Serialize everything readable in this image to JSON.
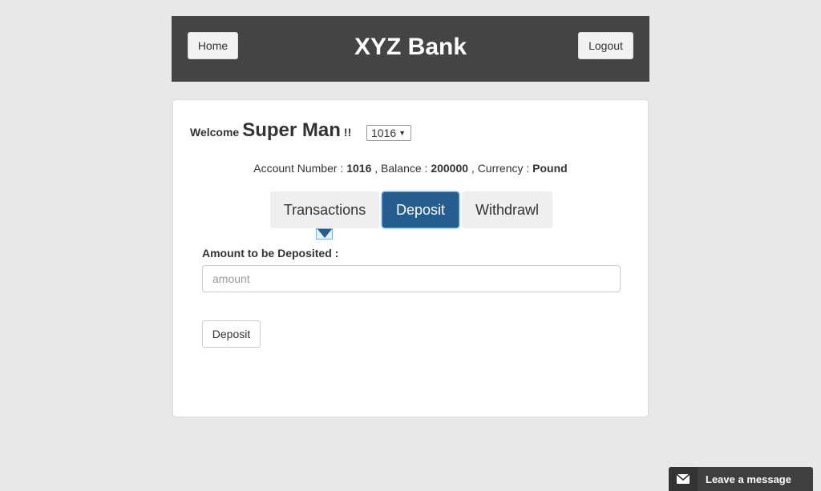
{
  "header": {
    "home_label": "Home",
    "title": "XYZ Bank",
    "logout_label": "Logout"
  },
  "welcome": {
    "prefix": "Welcome",
    "user_name": "Super Man",
    "suffix": "!!",
    "selected_account": "1016"
  },
  "account_info": {
    "number_label": "Account Number :",
    "number": "1016",
    "balance_label": ", Balance :",
    "balance": "200000",
    "currency_label": ", Currency :",
    "currency": "Pound"
  },
  "tabs": {
    "transactions": "Transactions",
    "deposit": "Deposit",
    "withdrawl": "Withdrawl",
    "active": "Deposit"
  },
  "deposit_form": {
    "amount_label": "Amount to be Deposited :",
    "amount_value": "",
    "amount_placeholder": "amount",
    "submit_label": "Deposit"
  },
  "chat": {
    "label": "Leave a message",
    "icon": "envelope-icon"
  },
  "colors": {
    "header_bg": "#444444",
    "active_tab": "#255d8f",
    "page_bg": "#e8e8e8"
  }
}
